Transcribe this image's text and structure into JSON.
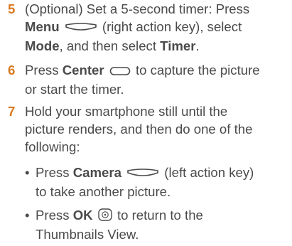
{
  "steps": [
    {
      "number": "5",
      "parts": {
        "a": "(Optional) Set a 5-second timer: Press",
        "b1": "Menu",
        "b2": "(right action key), select",
        "c1": "Mode",
        "c2": ", and then select",
        "c3": "Timer",
        "c4": "."
      }
    },
    {
      "number": "6",
      "parts": {
        "a1": "Press",
        "a2": "Center",
        "a3": "to capture the picture",
        "b": "or start the timer."
      }
    },
    {
      "number": "7",
      "parts": {
        "a": "Hold your smartphone still until the",
        "b": "picture renders, and then do one of the",
        "c": "following:"
      }
    }
  ],
  "bullets": [
    {
      "marker": "•",
      "a1": "Press",
      "a2": "Camera",
      "a3": "(left action key)",
      "b": "to take another picture."
    },
    {
      "marker": "•",
      "a1": "Press",
      "a2": "OK",
      "a3": "to return to the",
      "b": "Thumbnails View."
    }
  ]
}
